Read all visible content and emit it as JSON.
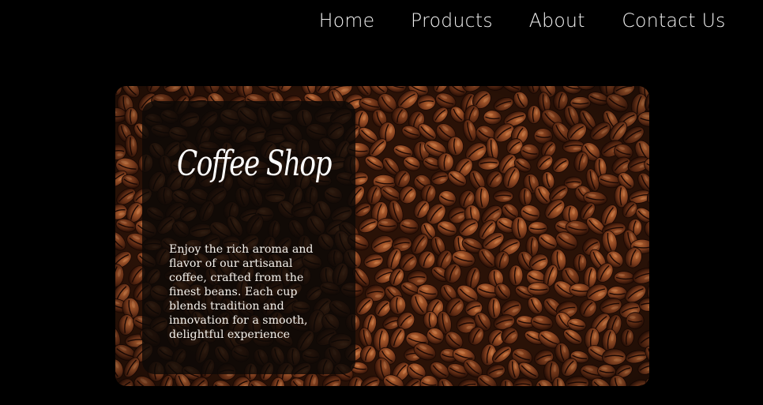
{
  "nav": {
    "items": [
      "Home",
      "Products",
      "About",
      "Contact Us"
    ]
  },
  "hero": {
    "title": "Coffee Shop",
    "description": "Enjoy the rich aroma and flavor of our artisanal coffee, crafted from the finest beans. Each cup blends tradition and innovation for a smooth, delightful experience",
    "image_icon": "coffee-beans-image"
  },
  "colors": {
    "background": "#000000",
    "nav_text": "#f2f2f2",
    "card_bg": "#0c0806",
    "bean_dark": "#3b1a0c",
    "bean_mid": "#7a3a1c",
    "bean_light": "#a8582c"
  }
}
